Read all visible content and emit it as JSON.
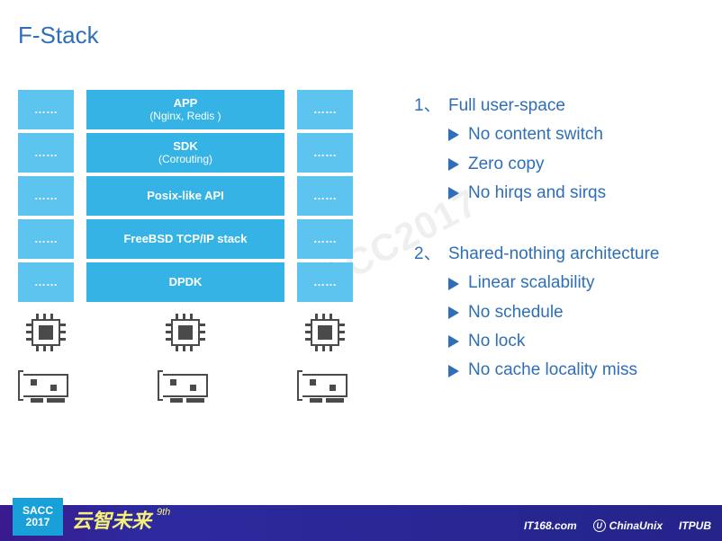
{
  "title": "F-Stack",
  "watermark": "SACC2017",
  "narrow_placeholder": "……",
  "stack": {
    "app": {
      "line1": "APP",
      "line2": "(Nginx, Redis )"
    },
    "sdk": {
      "line1": "SDK",
      "line2": "(Corouting)"
    },
    "posix": "Posix-like API",
    "freebsd": "FreeBSD TCP/IP stack",
    "dpdk": "DPDK"
  },
  "points": {
    "h1_num": "1、",
    "h1": "Full user-space",
    "p1": "No content switch",
    "p2": "Zero copy",
    "p3": "No hirqs and sirqs",
    "h2_num": "2、",
    "h2": "Shared-nothing architecture",
    "p4": "Linear scalability",
    "p5": "No schedule",
    "p6": "No lock",
    "p7": "No cache locality miss"
  },
  "footer": {
    "sacc": "SACC",
    "year": "2017",
    "cn": "云智未来",
    "ninth": "9th",
    "s1": "IT168.com",
    "s2u": "U",
    "s2": "ChinaUnix",
    "s3": "ITPUB"
  }
}
